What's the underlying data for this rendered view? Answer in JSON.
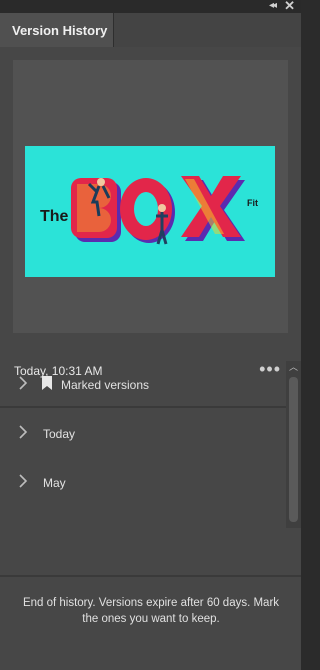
{
  "window": {
    "collapse_icon": "double-chevron-left-icon",
    "close_icon": "close-icon"
  },
  "tab": {
    "label": "Version History"
  },
  "current": {
    "time": "Today, 10:31 AM",
    "more_label": "•••"
  },
  "logo": {
    "the": "The",
    "box": "BOX",
    "fit": "Fit"
  },
  "versions": {
    "items": [
      {
        "label": "Marked versions",
        "icon": "bookmark-icon"
      },
      {
        "label": "Today"
      },
      {
        "label": "May"
      }
    ]
  },
  "footer": {
    "text": "End of history. Versions expire after 60 days. Mark the ones you want to keep."
  },
  "colors": {
    "panel_bg": "#474747",
    "preview_bg": "#525252",
    "logo_bg": "#2be3d8",
    "logo_red": "#e2264a",
    "logo_purple": "#5b2bb0",
    "logo_yellow": "#f5d423"
  }
}
